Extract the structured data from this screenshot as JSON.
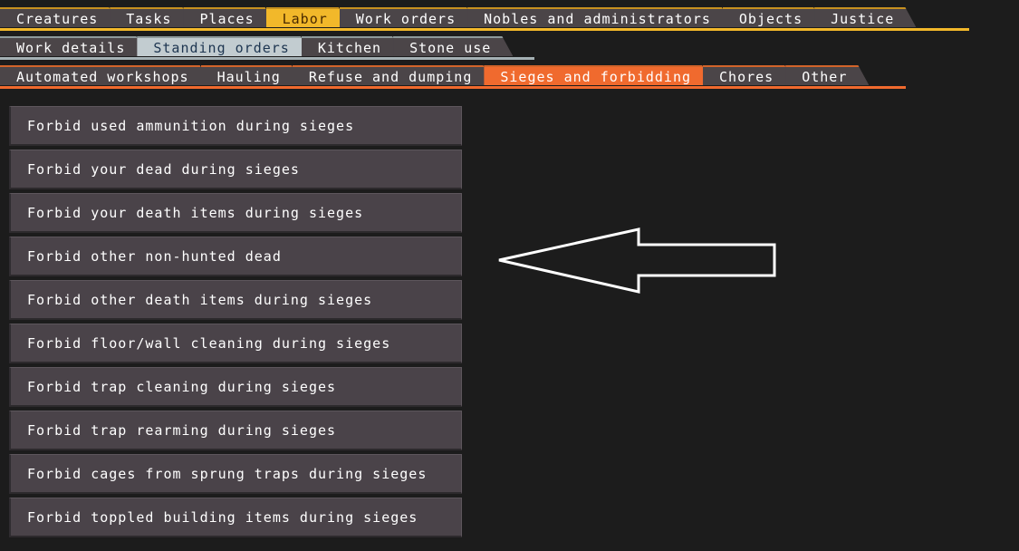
{
  "tabs_row1": [
    {
      "label": "Creatures",
      "active": false
    },
    {
      "label": "Tasks",
      "active": false
    },
    {
      "label": "Places",
      "active": false
    },
    {
      "label": "Labor",
      "active": true
    },
    {
      "label": "Work orders",
      "active": false
    },
    {
      "label": "Nobles and administrators",
      "active": false
    },
    {
      "label": "Objects",
      "active": false
    },
    {
      "label": "Justice",
      "active": false
    }
  ],
  "tabs_row2": [
    {
      "label": "Work details",
      "active": false
    },
    {
      "label": "Standing orders",
      "active": true
    },
    {
      "label": "Kitchen",
      "active": false
    },
    {
      "label": "Stone use",
      "active": false
    }
  ],
  "tabs_row3": [
    {
      "label": "Automated workshops",
      "active": false
    },
    {
      "label": "Hauling",
      "active": false
    },
    {
      "label": "Refuse and dumping",
      "active": false
    },
    {
      "label": "Sieges and forbidding",
      "active": true
    },
    {
      "label": "Chores",
      "active": false
    },
    {
      "label": "Other",
      "active": false
    }
  ],
  "orders": [
    "Forbid used ammunition during sieges",
    "Forbid your dead during sieges",
    "Forbid your death items during sieges",
    "Forbid other non-hunted dead",
    "Forbid other death items during sieges",
    "Forbid floor/wall cleaning during sieges",
    "Forbid trap cleaning during sieges",
    "Forbid trap rearming during sieges",
    "Forbid cages from sprung traps during sieges",
    "Forbid toppled building items during sieges"
  ],
  "colors": {
    "background": "#1c1c1c",
    "row1_active": "#f2b82a",
    "row2_active": "#c2ccd0",
    "row3_active": "#f06a2e",
    "item_bg": "#4a4349",
    "arrow": "#ffffff"
  }
}
